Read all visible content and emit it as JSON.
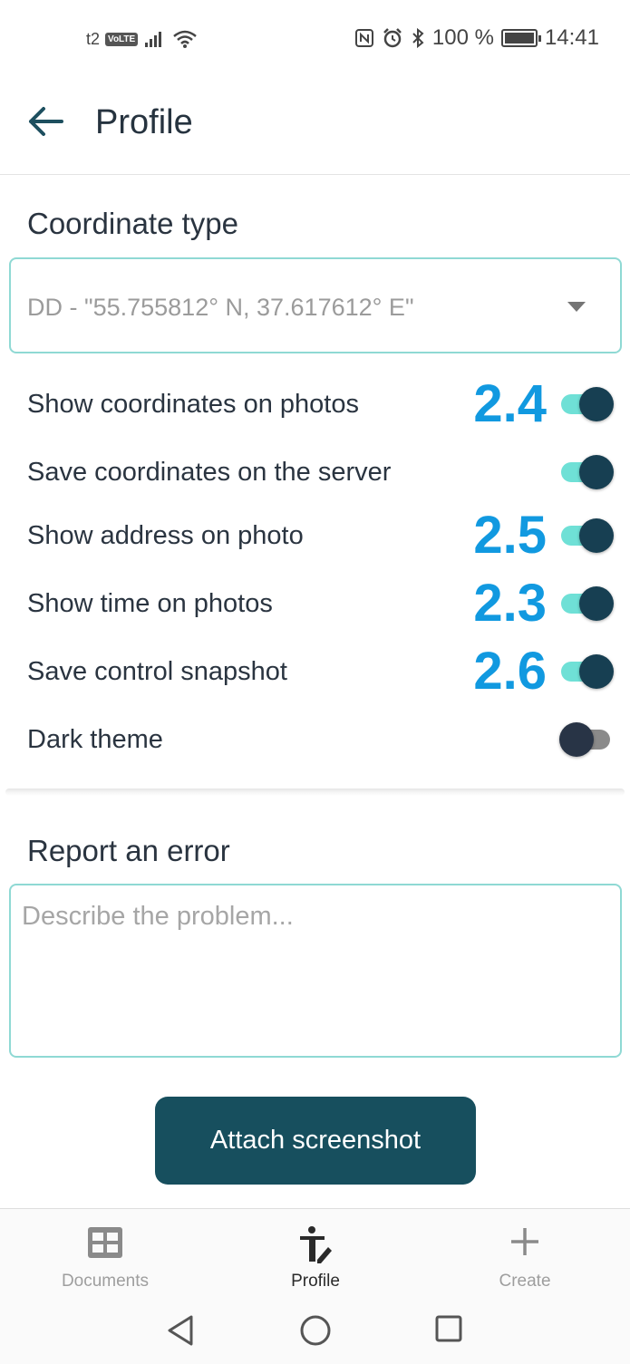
{
  "status_bar": {
    "carrier": "t2",
    "volte": "VoLTE",
    "battery": "100 %",
    "time": "14:41"
  },
  "app_bar": {
    "title": "Profile"
  },
  "coordinates": {
    "section_title": "Coordinate type",
    "selected_value": "DD - \"55.755812° N, 37.617612° E\""
  },
  "settings": [
    {
      "label": "Show coordinates on photos",
      "annotation": "2.4",
      "enabled": true
    },
    {
      "label": "Save coordinates on the server",
      "annotation": "",
      "enabled": true
    },
    {
      "label": "Show address on photo",
      "annotation": "2.5",
      "enabled": true
    },
    {
      "label": "Show time on photos",
      "annotation": "2.3",
      "enabled": true
    },
    {
      "label": "Save control snapshot",
      "annotation": "2.6",
      "enabled": true
    },
    {
      "label": "Dark theme",
      "annotation": "",
      "enabled": false
    }
  ],
  "report": {
    "section_title": "Report an error",
    "placeholder": "Describe the problem...",
    "attach_label": "Attach screenshot"
  },
  "bottom_nav": {
    "items": [
      {
        "label": "Documents",
        "icon": "grid-icon",
        "active": false
      },
      {
        "label": "Profile",
        "icon": "profile-edit-icon",
        "active": true
      },
      {
        "label": "Create",
        "icon": "plus-icon",
        "active": false
      }
    ]
  },
  "colors": {
    "accent": "#174f5e",
    "toggle_track_on": "#6fe0d6",
    "annotation": "#1199e0",
    "field_border": "#8fd9d4"
  }
}
